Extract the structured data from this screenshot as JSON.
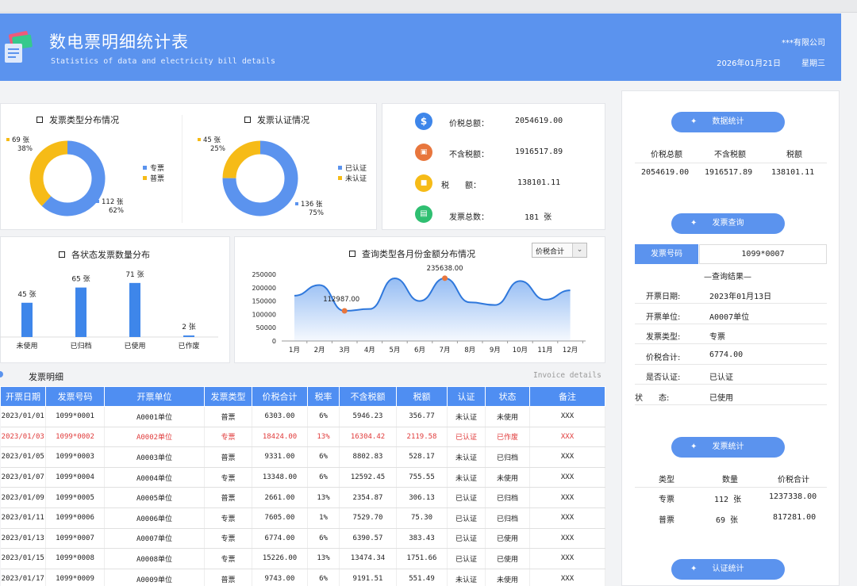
{
  "header": {
    "title": "数电票明细统计表",
    "subtitle": "Statistics of data and electricity bill details",
    "company": "***有限公司",
    "date": "2026年01月21日",
    "weekday": "星期三"
  },
  "type_donut": {
    "title": "发票类型分布情况",
    "legend": [
      "专票",
      "普票"
    ],
    "small_label_count": "69 张",
    "small_label_pct": "38%",
    "large_label_count": "112 张",
    "large_label_pct": "62%"
  },
  "auth_donut": {
    "title": "发票认证情况",
    "legend": [
      "已认证",
      "未认证"
    ],
    "small_label_count": "45 张",
    "small_label_pct": "25%",
    "large_label_count": "136 张",
    "large_label_pct": "75%"
  },
  "summary": {
    "total_label": "价税总额：",
    "total_value": "2054619.00",
    "notax_label": "不含税额：",
    "notax_value": "1916517.89",
    "tax_label": "税　　额：",
    "tax_value": "138101.11",
    "count_label": "发票总数：",
    "count_value": "181 张"
  },
  "status_chart_title": "各状态发票数量分布",
  "query_chart_title": "查询类型各月份金额分布情况",
  "dropdown_value": "价税合计",
  "detail": {
    "title": "发票明细",
    "title_en": "Invoice details",
    "headers": [
      "开票日期",
      "发票号码",
      "开票单位",
      "发票类型",
      "价税合计",
      "税率",
      "不含税额",
      "税额",
      "认证",
      "状态",
      "备注"
    ],
    "rows": [
      [
        "2023/01/01",
        "1099*0001",
        "A0001单位",
        "普票",
        "6303.00",
        "6%",
        "5946.23",
        "356.77",
        "未认证",
        "未使用",
        "XXX"
      ],
      [
        "2023/01/03",
        "1099*0002",
        "A0002单位",
        "专票",
        "18424.00",
        "13%",
        "16304.42",
        "2119.58",
        "已认证",
        "已作废",
        "XXX"
      ],
      [
        "2023/01/05",
        "1099*0003",
        "A0003单位",
        "普票",
        "9331.00",
        "6%",
        "8802.83",
        "528.17",
        "未认证",
        "已归档",
        "XXX"
      ],
      [
        "2023/01/07",
        "1099*0004",
        "A0004单位",
        "专票",
        "13348.00",
        "6%",
        "12592.45",
        "755.55",
        "未认证",
        "未使用",
        "XXX"
      ],
      [
        "2023/01/09",
        "1099*0005",
        "A0005单位",
        "普票",
        "2661.00",
        "13%",
        "2354.87",
        "306.13",
        "已认证",
        "已归档",
        "XXX"
      ],
      [
        "2023/01/11",
        "1099*0006",
        "A0006单位",
        "专票",
        "7605.00",
        "1%",
        "7529.70",
        "75.30",
        "已认证",
        "已归档",
        "XXX"
      ],
      [
        "2023/01/13",
        "1099*0007",
        "A0007单位",
        "专票",
        "6774.00",
        "6%",
        "6390.57",
        "383.43",
        "已认证",
        "已使用",
        "XXX"
      ],
      [
        "2023/01/15",
        "1099*0008",
        "A0008单位",
        "专票",
        "15226.00",
        "13%",
        "13474.34",
        "1751.66",
        "已认证",
        "已使用",
        "XXX"
      ],
      [
        "2023/01/17",
        "1099*0009",
        "A0009单位",
        "普票",
        "9743.00",
        "6%",
        "9191.51",
        "551.49",
        "未认证",
        "未使用",
        "XXX"
      ]
    ]
  },
  "right_panel": {
    "data_stats_button": "数据统计",
    "data_stats_headers": [
      "价税总额",
      "不含税额",
      "税额"
    ],
    "data_stats_values": [
      "2054619.00",
      "1916517.89",
      "138101.11"
    ],
    "query_button": "发票查询",
    "invoice_no_label": "发票号码",
    "invoice_no_value": "1099*0007",
    "result_title": "—查询结果—",
    "results": [
      {
        "label": "开票日期:",
        "value": "2023年01月13日"
      },
      {
        "label": "开票单位:",
        "value": "A0007单位"
      },
      {
        "label": "发票类型:",
        "value": "专票"
      },
      {
        "label": "价税合计:",
        "value": "6774.00"
      },
      {
        "label": "是否认证:",
        "value": "已认证"
      },
      {
        "label": "状　　态:",
        "value": "已使用"
      }
    ],
    "invoice_stats_button": "发票统计",
    "invoice_stats_headers": [
      "类型",
      "数量",
      "价税合计"
    ],
    "invoice_stats_rows": [
      [
        "专票",
        "112 张",
        "1237338.00"
      ],
      [
        "普票",
        "69 张",
        "817281.00"
      ]
    ],
    "auth_stats_button": "认证统计"
  },
  "colors": {
    "brand": "#5b93ee",
    "yellow": "#f6bb17",
    "orange": "#e8763d",
    "green": "#2fbf71",
    "red": "#e03a3a"
  },
  "chart_data": [
    {
      "type": "pie",
      "title": "发票类型分布情况",
      "categories": [
        "专票",
        "普票"
      ],
      "values": [
        112,
        69
      ],
      "percent": [
        62,
        38
      ]
    },
    {
      "type": "pie",
      "title": "发票认证情况",
      "categories": [
        "已认证",
        "未认证"
      ],
      "values": [
        136,
        45
      ],
      "percent": [
        75,
        25
      ]
    },
    {
      "type": "bar",
      "title": "各状态发票数量分布",
      "categories": [
        "未使用",
        "已归档",
        "已使用",
        "已作废"
      ],
      "values": [
        45,
        65,
        71,
        2
      ],
      "value_labels": [
        "45 张",
        "65 张",
        "71 张",
        "2 张"
      ]
    },
    {
      "type": "area",
      "title": "查询类型各月份金额分布情况",
      "categories": [
        "1月",
        "2月",
        "3月",
        "4月",
        "5月",
        "6月",
        "7月",
        "8月",
        "9月",
        "10月",
        "11月",
        "12月"
      ],
      "values": [
        170000,
        210000,
        112987,
        120000,
        235000,
        150000,
        235638,
        145000,
        135000,
        225000,
        155000,
        190000
      ],
      "ylim": [
        0,
        250000
      ],
      "yticks": [
        "0",
        "50000",
        "100000",
        "150000",
        "200000",
        "250000"
      ],
      "annotations": [
        {
          "x": "3月",
          "y": 112987,
          "label": "112987.00"
        },
        {
          "x": "7月",
          "y": 235638,
          "label": "235638.00"
        }
      ]
    }
  ]
}
